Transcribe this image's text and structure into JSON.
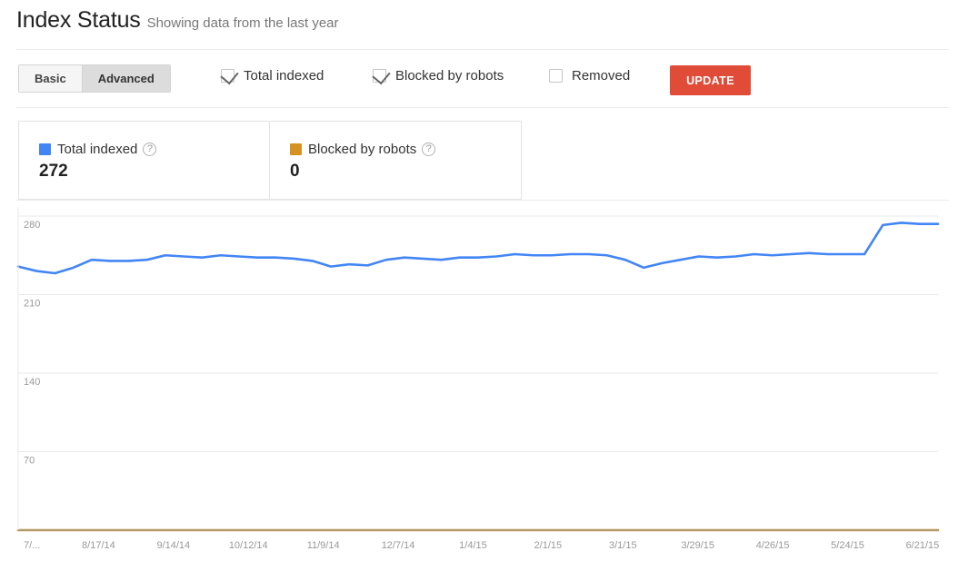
{
  "header": {
    "title": "Index Status",
    "subtitle": "Showing data from the last year"
  },
  "toolbar": {
    "tabs": [
      {
        "label": "Basic",
        "selected": false
      },
      {
        "label": "Advanced",
        "selected": true
      }
    ],
    "checkboxes": [
      {
        "label": "Total indexed",
        "checked": true
      },
      {
        "label": "Blocked by robots",
        "checked": true
      },
      {
        "label": "Removed",
        "checked": false
      }
    ],
    "update_label": "UPDATE",
    "update_color": "#e04c38"
  },
  "cards": [
    {
      "name": "Total indexed",
      "value": "272",
      "color": "#4285f4",
      "help_icon": "question-mark-icon",
      "help_glyph": "?"
    },
    {
      "name": "Blocked by robots",
      "value": "0",
      "color": "#d59121",
      "help_icon": "question-mark-icon",
      "help_glyph": "?"
    }
  ],
  "chart_data": {
    "type": "line",
    "title": "",
    "xlabel": "",
    "ylabel": "",
    "grid": true,
    "legend_position": "above-chart",
    "ylim": [
      0,
      290
    ],
    "yticks": [
      70,
      140,
      210,
      280
    ],
    "ytick_labels": [
      "70",
      "140",
      "210",
      "280"
    ],
    "xtick_labels": [
      "7/...",
      "8/17/14",
      "9/14/14",
      "10/12/14",
      "11/9/14",
      "12/7/14",
      "1/4/15",
      "2/1/15",
      "3/1/15",
      "3/29/15",
      "4/26/15",
      "5/24/15",
      "6/21/15"
    ],
    "x": [
      "7/20/14",
      "7/27/14",
      "8/3/14",
      "8/10/14",
      "8/17/14",
      "8/24/14",
      "8/31/14",
      "9/7/14",
      "9/14/14",
      "9/21/14",
      "9/28/14",
      "10/5/14",
      "10/12/14",
      "10/19/14",
      "10/26/14",
      "11/2/14",
      "11/9/14",
      "11/16/14",
      "11/23/14",
      "11/30/14",
      "12/7/14",
      "12/14/14",
      "12/21/14",
      "12/28/14",
      "1/4/15",
      "1/11/15",
      "1/18/15",
      "1/25/15",
      "2/1/15",
      "2/8/15",
      "2/15/15",
      "2/22/15",
      "3/1/15",
      "3/8/15",
      "3/15/15",
      "3/22/15",
      "3/29/15",
      "4/5/15",
      "4/12/15",
      "4/19/15",
      "4/26/15",
      "5/3/15",
      "5/10/15",
      "5/17/15",
      "5/24/15",
      "5/31/15",
      "6/7/15",
      "6/14/15",
      "6/21/15",
      "6/28/15",
      "7/5/15"
    ],
    "series": [
      {
        "name": "Total indexed",
        "color": "#4285f4",
        "values": [
          235,
          231,
          229,
          234,
          241,
          240,
          240,
          241,
          245,
          244,
          243,
          245,
          244,
          243,
          243,
          242,
          240,
          235,
          237,
          236,
          241,
          243,
          242,
          241,
          243,
          243,
          244,
          246,
          245,
          245,
          246,
          246,
          245,
          241,
          234,
          238,
          241,
          244,
          243,
          244,
          246,
          245,
          246,
          247,
          246,
          246,
          246,
          272,
          274,
          273,
          273
        ]
      },
      {
        "name": "Blocked by robots",
        "color": "#d59121",
        "values": [
          0,
          0,
          0,
          0,
          0,
          0,
          0,
          0,
          0,
          0,
          0,
          0,
          0,
          0,
          0,
          0,
          0,
          0,
          0,
          0,
          0,
          0,
          0,
          0,
          0,
          0,
          0,
          0,
          0,
          0,
          0,
          0,
          0,
          0,
          0,
          0,
          0,
          0,
          0,
          0,
          0,
          0,
          0,
          0,
          0,
          0,
          0,
          0,
          0,
          0,
          0
        ]
      }
    ]
  }
}
